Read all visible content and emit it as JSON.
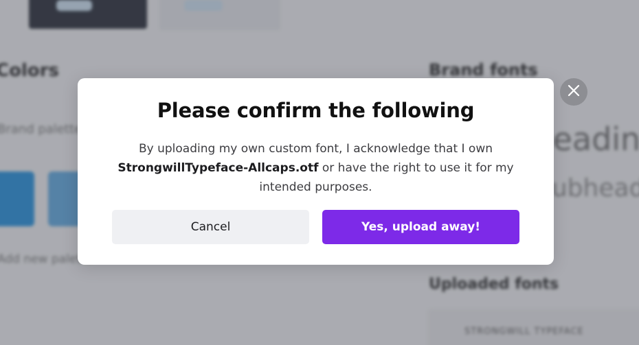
{
  "background": {
    "left_heading": "Colors",
    "left_text": "Brand palette",
    "left_text2": "Add new palette",
    "right_heading": "Brand fonts",
    "right_big_heading": "Heading",
    "right_sub_heading": "Subheading",
    "uploaded_heading": "Uploaded fonts",
    "font_row_text": "STRONGWILL TYPEFACE"
  },
  "modal": {
    "title": "Please confirm the following",
    "body_prefix": "By uploading my own custom font, I acknowledge that I own",
    "filename": "StrongwillTypeface-Allcaps.otf",
    "body_suffix": "or have the right to use it for my intended purposes.",
    "cancel_label": "Cancel",
    "confirm_label": "Yes, upload away!"
  },
  "icons": {
    "close": "close-icon"
  },
  "colors": {
    "primary_button": "#7d2ae8",
    "secondary_button": "#eff0f3",
    "close_button": "#8d8e93"
  }
}
